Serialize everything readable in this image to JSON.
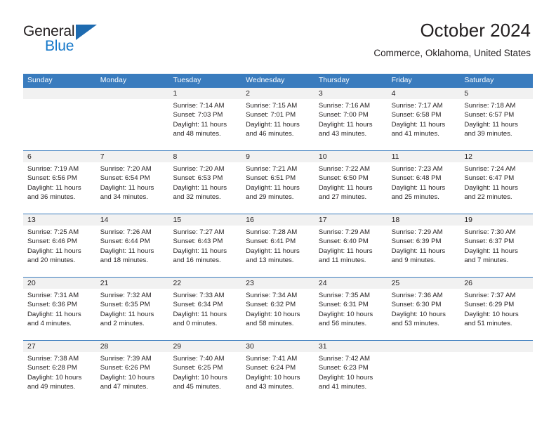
{
  "brand": {
    "name_part1": "General",
    "name_part2": "Blue",
    "triangle_color": "#1e6bb0",
    "blue_text_color": "#1477c9"
  },
  "header": {
    "title": "October 2024",
    "subtitle": "Commerce, Oklahoma, United States"
  },
  "theme": {
    "header_bar_color": "#3a7cbe",
    "date_band_color": "#f1f1f1",
    "text_color": "#231f20"
  },
  "weekdays": [
    "Sunday",
    "Monday",
    "Tuesday",
    "Wednesday",
    "Thursday",
    "Friday",
    "Saturday"
  ],
  "weeks": [
    {
      "days": [
        {
          "num": "",
          "sunrise": "",
          "sunset": "",
          "daylight": ""
        },
        {
          "num": "",
          "sunrise": "",
          "sunset": "",
          "daylight": ""
        },
        {
          "num": "1",
          "sunrise": "Sunrise: 7:14 AM",
          "sunset": "Sunset: 7:03 PM",
          "daylight": "Daylight: 11 hours and 48 minutes."
        },
        {
          "num": "2",
          "sunrise": "Sunrise: 7:15 AM",
          "sunset": "Sunset: 7:01 PM",
          "daylight": "Daylight: 11 hours and 46 minutes."
        },
        {
          "num": "3",
          "sunrise": "Sunrise: 7:16 AM",
          "sunset": "Sunset: 7:00 PM",
          "daylight": "Daylight: 11 hours and 43 minutes."
        },
        {
          "num": "4",
          "sunrise": "Sunrise: 7:17 AM",
          "sunset": "Sunset: 6:58 PM",
          "daylight": "Daylight: 11 hours and 41 minutes."
        },
        {
          "num": "5",
          "sunrise": "Sunrise: 7:18 AM",
          "sunset": "Sunset: 6:57 PM",
          "daylight": "Daylight: 11 hours and 39 minutes."
        }
      ]
    },
    {
      "days": [
        {
          "num": "6",
          "sunrise": "Sunrise: 7:19 AM",
          "sunset": "Sunset: 6:56 PM",
          "daylight": "Daylight: 11 hours and 36 minutes."
        },
        {
          "num": "7",
          "sunrise": "Sunrise: 7:20 AM",
          "sunset": "Sunset: 6:54 PM",
          "daylight": "Daylight: 11 hours and 34 minutes."
        },
        {
          "num": "8",
          "sunrise": "Sunrise: 7:20 AM",
          "sunset": "Sunset: 6:53 PM",
          "daylight": "Daylight: 11 hours and 32 minutes."
        },
        {
          "num": "9",
          "sunrise": "Sunrise: 7:21 AM",
          "sunset": "Sunset: 6:51 PM",
          "daylight": "Daylight: 11 hours and 29 minutes."
        },
        {
          "num": "10",
          "sunrise": "Sunrise: 7:22 AM",
          "sunset": "Sunset: 6:50 PM",
          "daylight": "Daylight: 11 hours and 27 minutes."
        },
        {
          "num": "11",
          "sunrise": "Sunrise: 7:23 AM",
          "sunset": "Sunset: 6:48 PM",
          "daylight": "Daylight: 11 hours and 25 minutes."
        },
        {
          "num": "12",
          "sunrise": "Sunrise: 7:24 AM",
          "sunset": "Sunset: 6:47 PM",
          "daylight": "Daylight: 11 hours and 22 minutes."
        }
      ]
    },
    {
      "days": [
        {
          "num": "13",
          "sunrise": "Sunrise: 7:25 AM",
          "sunset": "Sunset: 6:46 PM",
          "daylight": "Daylight: 11 hours and 20 minutes."
        },
        {
          "num": "14",
          "sunrise": "Sunrise: 7:26 AM",
          "sunset": "Sunset: 6:44 PM",
          "daylight": "Daylight: 11 hours and 18 minutes."
        },
        {
          "num": "15",
          "sunrise": "Sunrise: 7:27 AM",
          "sunset": "Sunset: 6:43 PM",
          "daylight": "Daylight: 11 hours and 16 minutes."
        },
        {
          "num": "16",
          "sunrise": "Sunrise: 7:28 AM",
          "sunset": "Sunset: 6:41 PM",
          "daylight": "Daylight: 11 hours and 13 minutes."
        },
        {
          "num": "17",
          "sunrise": "Sunrise: 7:29 AM",
          "sunset": "Sunset: 6:40 PM",
          "daylight": "Daylight: 11 hours and 11 minutes."
        },
        {
          "num": "18",
          "sunrise": "Sunrise: 7:29 AM",
          "sunset": "Sunset: 6:39 PM",
          "daylight": "Daylight: 11 hours and 9 minutes."
        },
        {
          "num": "19",
          "sunrise": "Sunrise: 7:30 AM",
          "sunset": "Sunset: 6:37 PM",
          "daylight": "Daylight: 11 hours and 7 minutes."
        }
      ]
    },
    {
      "days": [
        {
          "num": "20",
          "sunrise": "Sunrise: 7:31 AM",
          "sunset": "Sunset: 6:36 PM",
          "daylight": "Daylight: 11 hours and 4 minutes."
        },
        {
          "num": "21",
          "sunrise": "Sunrise: 7:32 AM",
          "sunset": "Sunset: 6:35 PM",
          "daylight": "Daylight: 11 hours and 2 minutes."
        },
        {
          "num": "22",
          "sunrise": "Sunrise: 7:33 AM",
          "sunset": "Sunset: 6:34 PM",
          "daylight": "Daylight: 11 hours and 0 minutes."
        },
        {
          "num": "23",
          "sunrise": "Sunrise: 7:34 AM",
          "sunset": "Sunset: 6:32 PM",
          "daylight": "Daylight: 10 hours and 58 minutes."
        },
        {
          "num": "24",
          "sunrise": "Sunrise: 7:35 AM",
          "sunset": "Sunset: 6:31 PM",
          "daylight": "Daylight: 10 hours and 56 minutes."
        },
        {
          "num": "25",
          "sunrise": "Sunrise: 7:36 AM",
          "sunset": "Sunset: 6:30 PM",
          "daylight": "Daylight: 10 hours and 53 minutes."
        },
        {
          "num": "26",
          "sunrise": "Sunrise: 7:37 AM",
          "sunset": "Sunset: 6:29 PM",
          "daylight": "Daylight: 10 hours and 51 minutes."
        }
      ]
    },
    {
      "days": [
        {
          "num": "27",
          "sunrise": "Sunrise: 7:38 AM",
          "sunset": "Sunset: 6:28 PM",
          "daylight": "Daylight: 10 hours and 49 minutes."
        },
        {
          "num": "28",
          "sunrise": "Sunrise: 7:39 AM",
          "sunset": "Sunset: 6:26 PM",
          "daylight": "Daylight: 10 hours and 47 minutes."
        },
        {
          "num": "29",
          "sunrise": "Sunrise: 7:40 AM",
          "sunset": "Sunset: 6:25 PM",
          "daylight": "Daylight: 10 hours and 45 minutes."
        },
        {
          "num": "30",
          "sunrise": "Sunrise: 7:41 AM",
          "sunset": "Sunset: 6:24 PM",
          "daylight": "Daylight: 10 hours and 43 minutes."
        },
        {
          "num": "31",
          "sunrise": "Sunrise: 7:42 AM",
          "sunset": "Sunset: 6:23 PM",
          "daylight": "Daylight: 10 hours and 41 minutes."
        },
        {
          "num": "",
          "sunrise": "",
          "sunset": "",
          "daylight": ""
        },
        {
          "num": "",
          "sunrise": "",
          "sunset": "",
          "daylight": ""
        }
      ]
    }
  ]
}
